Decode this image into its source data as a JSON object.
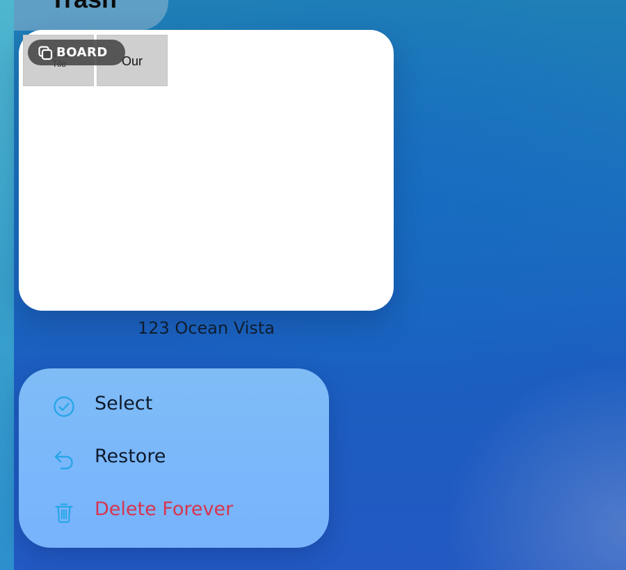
{
  "header": {
    "title": "Trash"
  },
  "board": {
    "badge_label": "BOARD",
    "badge_icon": "stacked-squares-icon",
    "tiles": [
      {
        "text": "New Tile"
      },
      {
        "text": "Our"
      }
    ],
    "caption": "123 Ocean Vista"
  },
  "menu": {
    "items": [
      {
        "label": "Select",
        "icon": "checkmark-circle-icon"
      },
      {
        "label": "Restore",
        "icon": "undo-arrow-icon"
      },
      {
        "label": "Delete Forever",
        "icon": "trash-icon",
        "color": "#d8344d"
      }
    ],
    "accent_color": "#27a6e8"
  }
}
